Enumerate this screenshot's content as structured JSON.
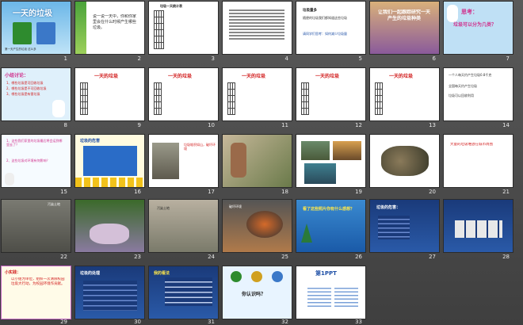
{
  "slides": [
    {
      "n": "1",
      "title": "一天的垃圾",
      "caption": "第一天产生的垃圾 这么多"
    },
    {
      "n": "2",
      "text": "说一说一天中，你和你家里会在什么时候产生哪些垃圾。"
    },
    {
      "n": "3",
      "title": "垃圾一天统计表"
    },
    {
      "n": "4"
    },
    {
      "n": "5",
      "heading": "垃圾量多",
      "sub": "随便的垃圾我们都知道这些垃圾",
      "link": "请同学们思考：如何减少垃圾量"
    },
    {
      "n": "6",
      "text": "让我们一起跟踪研究一天产生的垃圾种类"
    },
    {
      "n": "7",
      "title": "思考：",
      "sub": "垃圾可以分为几类？"
    },
    {
      "n": "8",
      "title": "小组讨论：",
      "bullets": [
        "1、哪些垃圾是可回收垃圾",
        "2、哪些垃圾是不可回收垃圾",
        "3、哪些垃圾是有害垃圾"
      ]
    },
    {
      "n": "9",
      "title": "一天的垃圾"
    },
    {
      "n": "10",
      "title": "一天的垃圾"
    },
    {
      "n": "11",
      "title": "一天的垃圾"
    },
    {
      "n": "12",
      "title": "一天的垃圾"
    },
    {
      "n": "13",
      "title": "一天的垃圾"
    },
    {
      "n": "14",
      "bullets": [
        "一个人每天约产生垃圾0.8千克",
        "全国每天约产生垃圾",
        "垃圾可以回收利用"
      ]
    },
    {
      "n": "15",
      "q1": "1、这些我们家里的垃圾最后将会运到哪里去了？",
      "q2": "2、这些垃圾对环境有何影响？"
    },
    {
      "n": "16",
      "title": "垃圾的危害"
    },
    {
      "n": "17",
      "text": "垃圾堆积如山，破坏环境"
    },
    {
      "n": "18"
    },
    {
      "n": "19"
    },
    {
      "n": "20"
    },
    {
      "n": "21",
      "text": "大量的垃圾堆放在城市周围"
    },
    {
      "n": "22",
      "caption": "污染土地"
    },
    {
      "n": "23"
    },
    {
      "n": "24",
      "caption": "污染土地"
    },
    {
      "n": "25",
      "caption": "破坏环境"
    },
    {
      "n": "26",
      "title": "看了这些照片你有什么感想？"
    },
    {
      "n": "27",
      "title": "垃圾的危害："
    },
    {
      "n": "28"
    },
    {
      "n": "29",
      "title": "小实践：",
      "text": "以小组为单位，组织一次清除校园垃圾大行动，为校园环境作贡献。"
    },
    {
      "n": "30",
      "title": "垃圾的处理"
    },
    {
      "n": "31",
      "title": "我的看法"
    },
    {
      "n": "32",
      "title": "你认识吗？"
    },
    {
      "n": "33",
      "title": "第1PPT"
    }
  ],
  "colors": {
    "sorterBg": "#505050",
    "accentBlue": "#1e4fa6",
    "accentPink": "#d0308c",
    "titleRed": "#d11b1b"
  }
}
